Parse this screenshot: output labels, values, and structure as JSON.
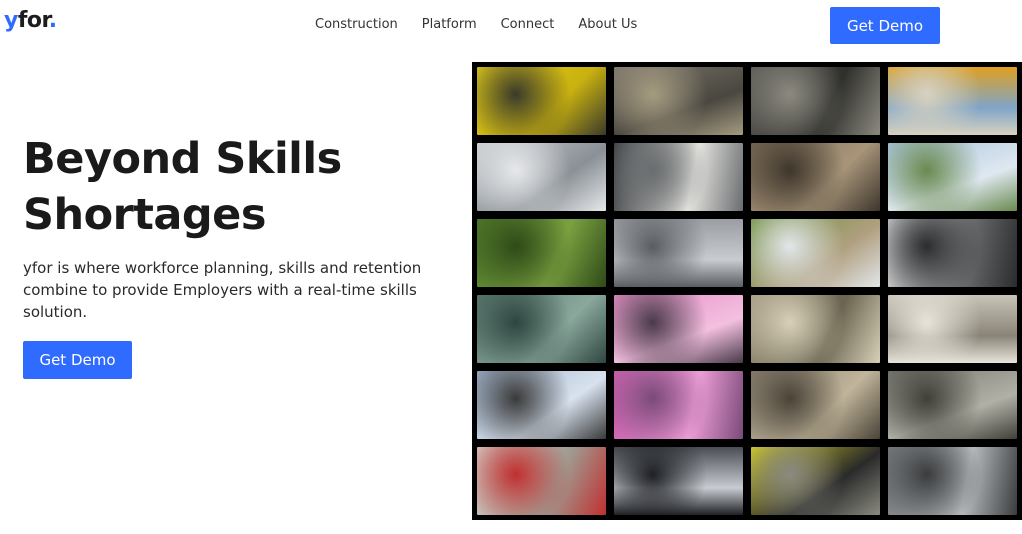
{
  "header": {
    "logo_prefix": "y",
    "logo_rest": "for",
    "logo_dot": ".",
    "nav": [
      {
        "label": "Construction"
      },
      {
        "label": "Platform"
      },
      {
        "label": "Connect"
      },
      {
        "label": "About Us"
      }
    ],
    "cta_label": "Get Demo"
  },
  "hero": {
    "title_line1": "Beyond Skills",
    "title_line2": "Shortages",
    "subtitle": "yfor is where workforce planning, skills and retention combine to provide Employers with a real-time skills solution.",
    "cta_label": "Get Demo"
  },
  "colors": {
    "accent": "#2f6bff",
    "mosaic_background": "#000000"
  },
  "mosaic": {
    "columns": 4,
    "rows": 6,
    "tiles": [
      {
        "name": "tile-yellow-bottles",
        "colors": [
          "#e8d21a",
          "#c9b10f",
          "#3a3a2a"
        ]
      },
      {
        "name": "tile-road-workers",
        "colors": [
          "#7a756a",
          "#4a4740",
          "#a59b80"
        ]
      },
      {
        "name": "tile-worker-boots",
        "colors": [
          "#5b5a55",
          "#2f2f2c",
          "#8c8a80"
        ]
      },
      {
        "name": "tile-hardhat-team",
        "colors": [
          "#e0a020",
          "#7fa5c8",
          "#d8d2c0"
        ]
      },
      {
        "name": "tile-factory-machine",
        "colors": [
          "#c8ccd0",
          "#8a9096",
          "#e6e8ea"
        ]
      },
      {
        "name": "tile-textile-spools",
        "colors": [
          "#3a3d40",
          "#e5e5e0",
          "#6a6d70"
        ]
      },
      {
        "name": "tile-industrial-pipe",
        "colors": [
          "#7b6a55",
          "#a8957a",
          "#3e362c"
        ]
      },
      {
        "name": "tile-wind-turbine",
        "colors": [
          "#a9c6e0",
          "#dfe8f0",
          "#6a8a50"
        ]
      },
      {
        "name": "tile-forest-trees",
        "colors": [
          "#4f7a28",
          "#7aa040",
          "#2e4a18"
        ]
      },
      {
        "name": "tile-metal-press",
        "colors": [
          "#9a9ea2",
          "#c8ccd0",
          "#5a5e62"
        ]
      },
      {
        "name": "tile-pipeline-field",
        "colors": [
          "#6c8f3a",
          "#b0a080",
          "#e2e6ea"
        ]
      },
      {
        "name": "tile-robot-arm",
        "colors": [
          "#d0d2d4",
          "#6a6c6e",
          "#2a2c2e"
        ]
      },
      {
        "name": "tile-glass-sphere",
        "colors": [
          "#5a7a70",
          "#8aa89c",
          "#2e4640"
        ]
      },
      {
        "name": "tile-pink-bottles",
        "colors": [
          "#e890c8",
          "#f3c0e0",
          "#4a3a4a"
        ]
      },
      {
        "name": "tile-assembly-gears",
        "colors": [
          "#a09880",
          "#6a6450",
          "#d8d0b8"
        ]
      },
      {
        "name": "tile-wall-worker",
        "colors": [
          "#c8c4b8",
          "#8a8478",
          "#e8e4da"
        ]
      },
      {
        "name": "tile-pump-jack",
        "colors": [
          "#9fb4cf",
          "#d8e2ee",
          "#3a3a3a"
        ]
      },
      {
        "name": "tile-pink-trays",
        "colors": [
          "#d060b0",
          "#f0a0d8",
          "#7a4a7a"
        ]
      },
      {
        "name": "tile-welding-hands",
        "colors": [
          "#8a8070",
          "#c0b49a",
          "#4a4438"
        ]
      },
      {
        "name": "tile-valve-machine",
        "colors": [
          "#7a7a72",
          "#b0b0a6",
          "#40403a"
        ]
      },
      {
        "name": "tile-cement-bags",
        "colors": [
          "#d8d4cc",
          "#a09a90",
          "#c03030"
        ]
      },
      {
        "name": "tile-car-part",
        "colors": [
          "#4a4e54",
          "#c8ccd2",
          "#1e2024"
        ]
      },
      {
        "name": "tile-vest-worker",
        "colors": [
          "#d8d020",
          "#2a2a2a",
          "#8a8a80"
        ]
      },
      {
        "name": "tile-water-splash",
        "colors": [
          "#7a7e80",
          "#b8bcbe",
          "#3a3c3e"
        ]
      }
    ]
  }
}
